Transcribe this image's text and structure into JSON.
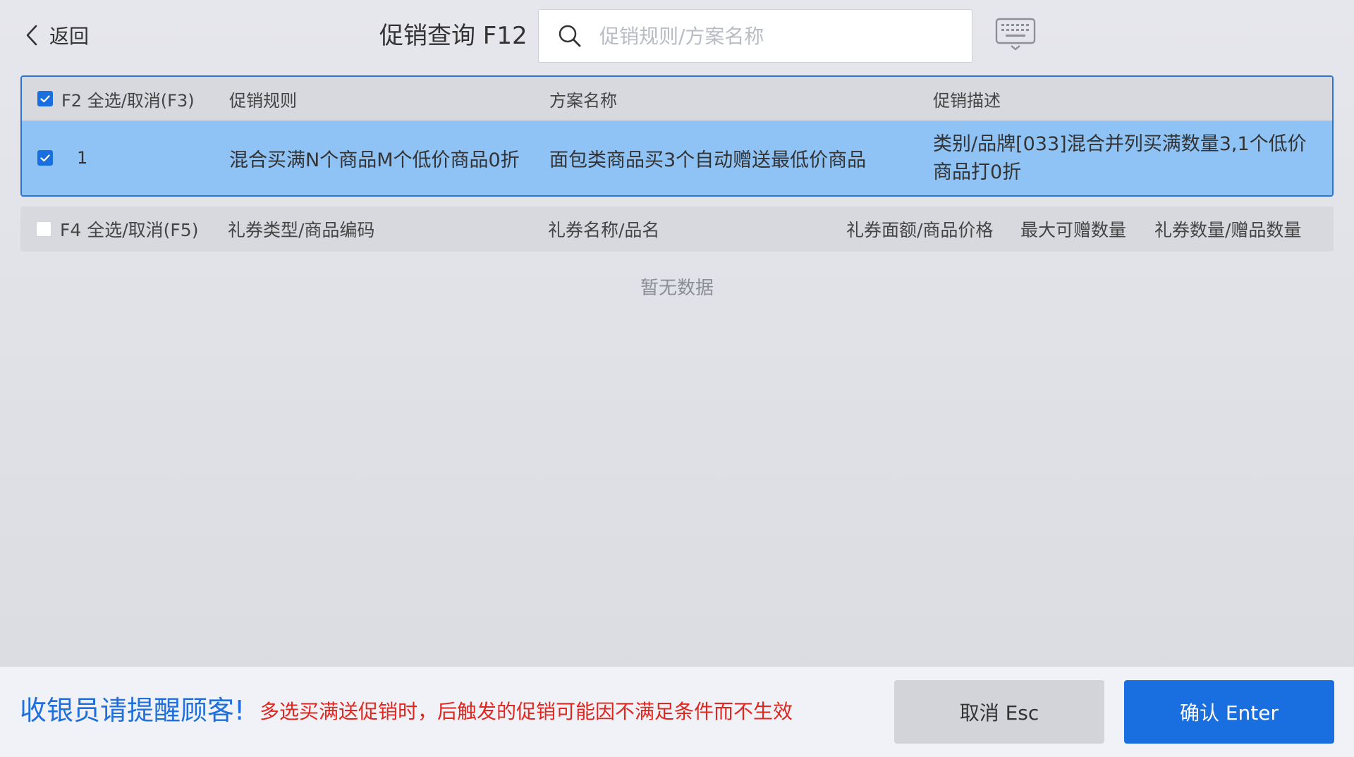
{
  "header": {
    "back_label": "返回",
    "title": "促销查询 F12",
    "search": {
      "placeholder": "促销规则/方案名称",
      "value": ""
    }
  },
  "promo_table": {
    "columns": {
      "select": "F2 全选/取消(F3)",
      "rule": "促销规则",
      "plan_name": "方案名称",
      "description": "促销描述"
    },
    "rows": [
      {
        "checked": true,
        "index": "1",
        "rule": "混合买满N个商品M个低价商品0折",
        "plan_name": "面包类商品买3个自动赠送最低价商品",
        "description_line1": "类别/品牌[033]混合并列买满数量3,1个低价",
        "description_line2": "商品打0折"
      }
    ],
    "header_checked": true
  },
  "gift_table": {
    "header_checked": false,
    "columns": {
      "select": "F4 全选/取消(F5)",
      "type_code": "礼券类型/商品编码",
      "name": "礼券名称/品名",
      "value_price": "礼券面额/商品价格",
      "max_qty": "最大可赠数量",
      "qty": "礼券数量/赠品数量"
    },
    "empty_text": "暂无数据"
  },
  "footer": {
    "remind_title": "收银员请提醒顾客!",
    "remind_text": "多选买满送促销时，后触发的促销可能因不满足条件而不生效",
    "cancel_label": "取消 Esc",
    "confirm_label": "确认 Enter"
  },
  "colors": {
    "accent": "#1a6fe0",
    "selected_row": "#90c3f5",
    "warning": "#e0261f"
  }
}
